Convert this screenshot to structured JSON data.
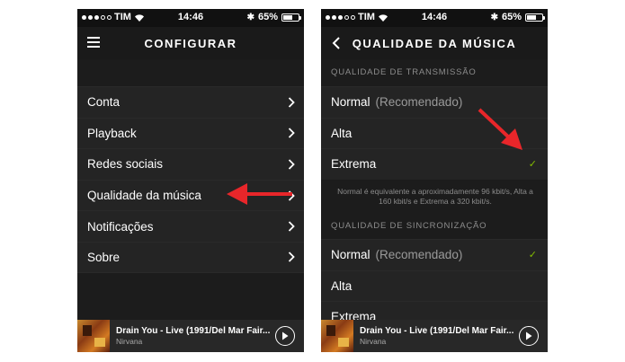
{
  "status_bar": {
    "carrier": "TIM",
    "time": "14:46",
    "battery": "65%",
    "battery_level": 0.65
  },
  "left_screen": {
    "title": "CONFIGURAR",
    "menu_items": [
      {
        "label": "Conta"
      },
      {
        "label": "Playback"
      },
      {
        "label": "Redes sociais"
      },
      {
        "label": "Qualidade da música"
      },
      {
        "label": "Notificações"
      },
      {
        "label": "Sobre"
      }
    ]
  },
  "right_screen": {
    "title": "QUALIDADE DA MÚSICA",
    "streaming_header": "QUALIDADE DE TRANSMISSÃO",
    "streaming_options": [
      {
        "label": "Normal",
        "note": "(Recomendado)",
        "checked": false
      },
      {
        "label": "Alta",
        "note": "",
        "checked": false
      },
      {
        "label": "Extrema",
        "note": "",
        "checked": true
      }
    ],
    "info_text": "Normal é equivalente a aproximadamente 96 kbit/s, Alta a 160 kbit/s e Extrema a 320 kbit/s.",
    "sync_header": "QUALIDADE DE SINCRONIZAÇÃO",
    "sync_options": [
      {
        "label": "Normal",
        "note": "(Recomendado)",
        "checked": true
      },
      {
        "label": "Alta",
        "note": "",
        "checked": false
      },
      {
        "label": "Extrema",
        "note": "",
        "checked": false
      }
    ]
  },
  "now_playing": {
    "title": "Drain You - Live (1991/Del Mar Fair...",
    "artist": "Nirvana"
  },
  "colors": {
    "accent_green": "#84bd00",
    "annotation_red": "#e8262a"
  }
}
